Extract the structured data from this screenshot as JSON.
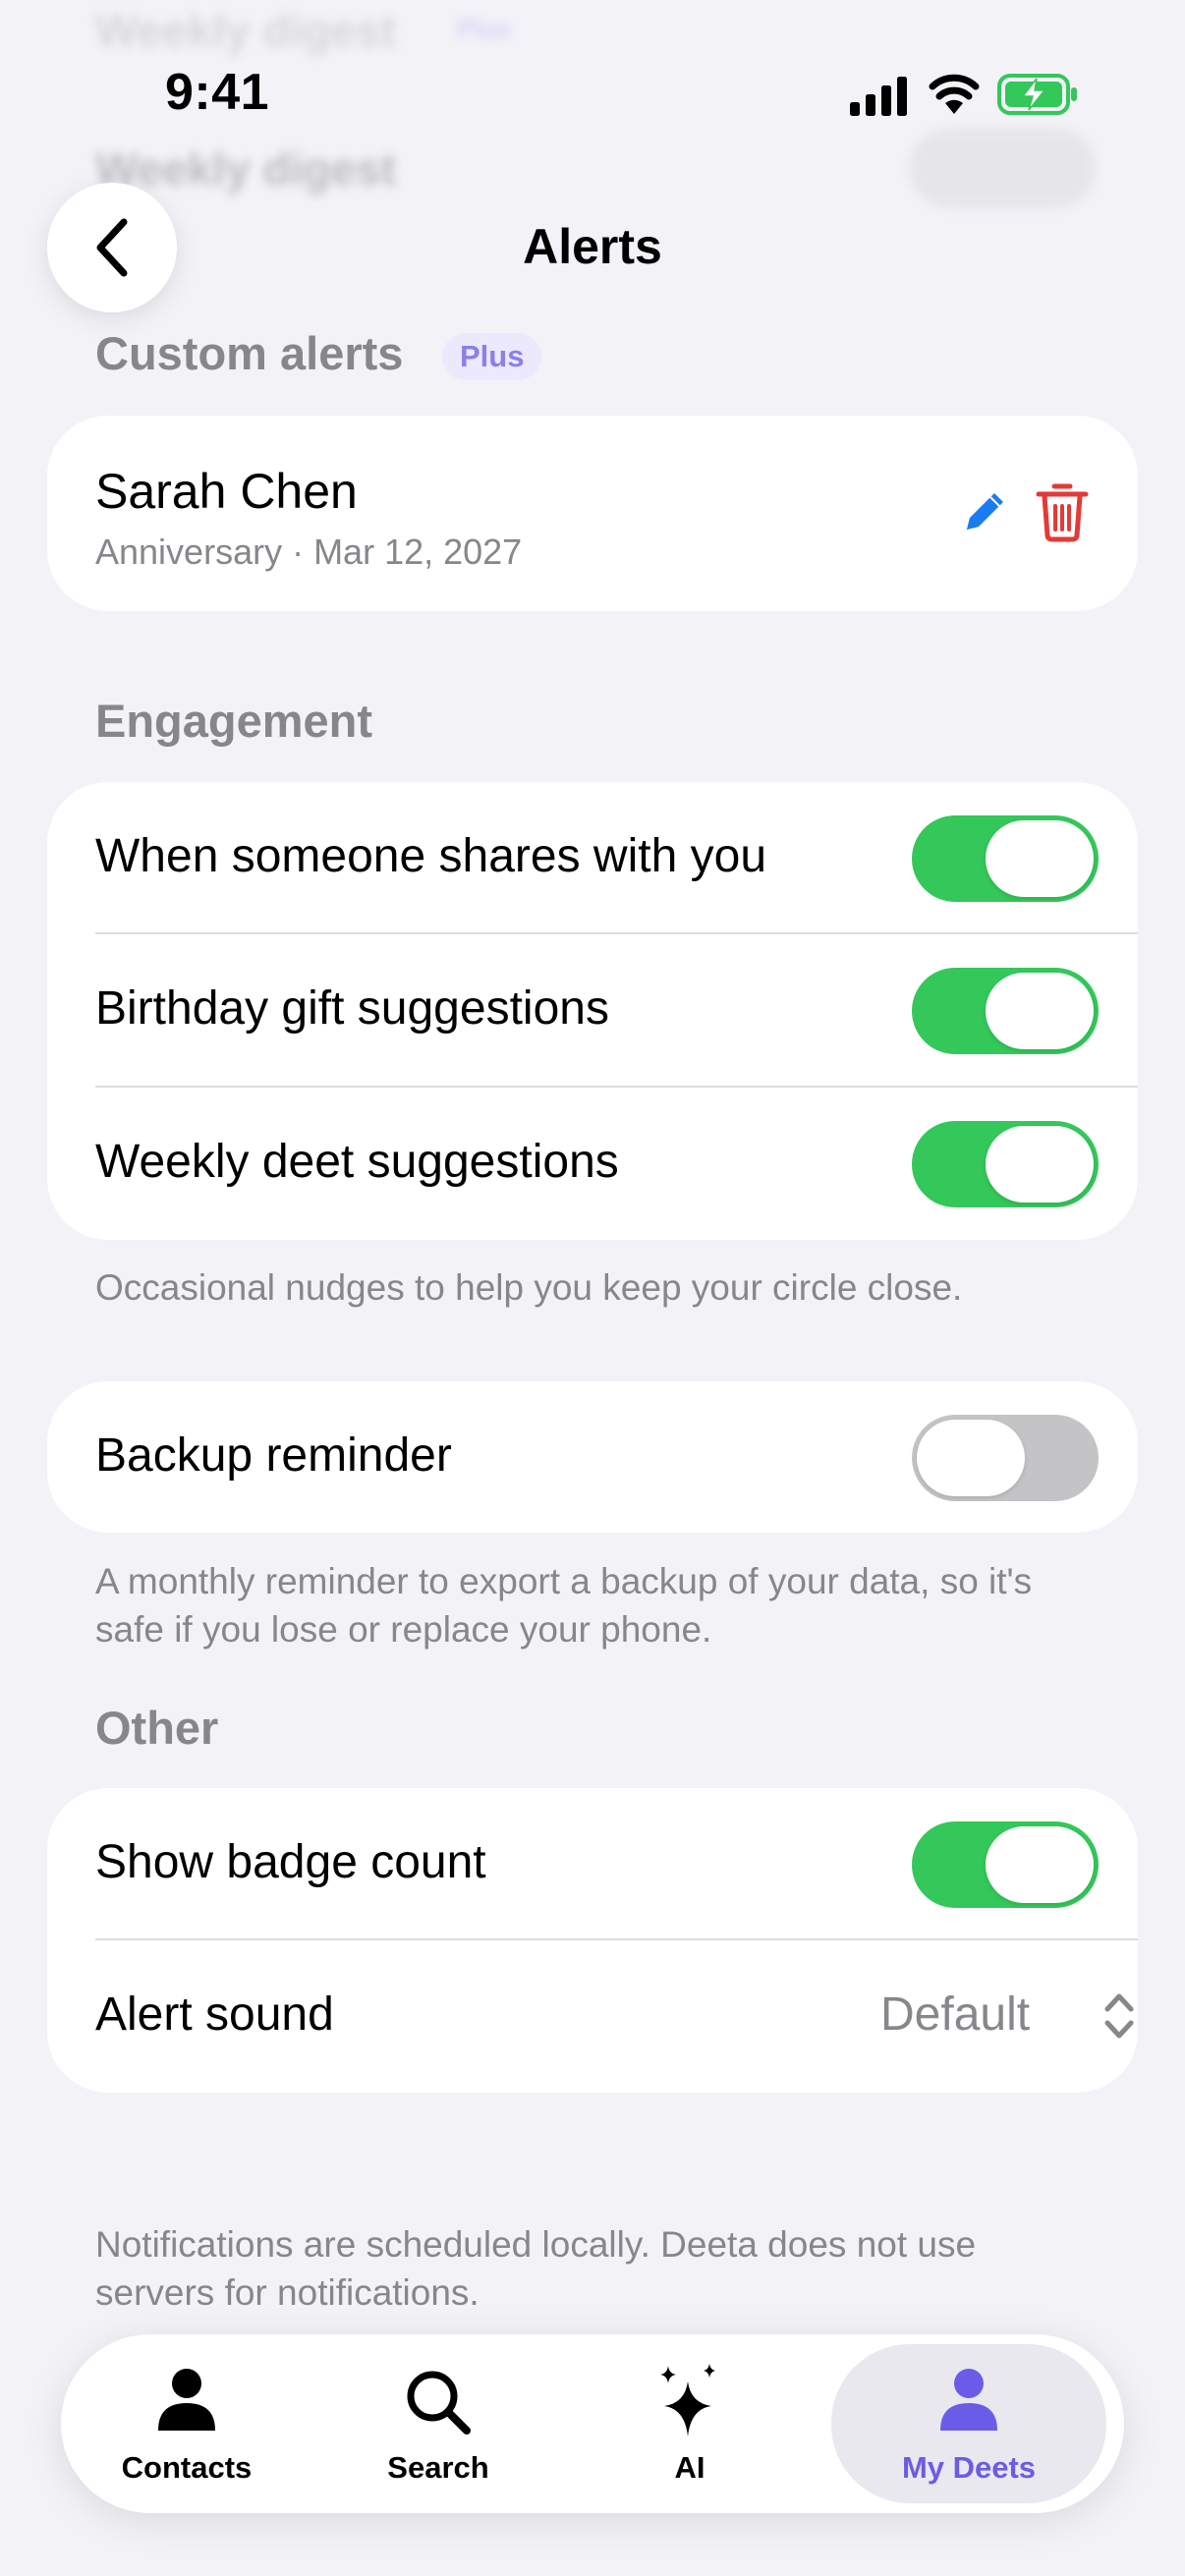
{
  "status_bar": {
    "time": "9:41"
  },
  "background_ghost": {
    "line1": "Weekly digest",
    "plus": "Plus",
    "line2": "Weekly digest"
  },
  "nav": {
    "title": "Alerts"
  },
  "custom_alerts": {
    "header": "Custom alerts",
    "badge": "Plus",
    "item": {
      "name": "Sarah Chen",
      "detail": "Anniversary · Mar 12, 2027"
    }
  },
  "engagement": {
    "header": "Engagement",
    "rows": [
      {
        "label": "When someone shares with you",
        "on": true
      },
      {
        "label": "Birthday gift suggestions",
        "on": true
      },
      {
        "label": "Weekly deet suggestions",
        "on": true
      }
    ],
    "footnote": "Occasional nudges to help you keep your circle close."
  },
  "backup": {
    "label": "Backup reminder",
    "on": false,
    "footnote": "A monthly reminder to export a backup of your data, so it's safe if you lose or replace your phone."
  },
  "other": {
    "header": "Other",
    "badge_count": {
      "label": "Show badge count",
      "on": true
    },
    "alert_sound": {
      "label": "Alert sound",
      "value": "Default"
    }
  },
  "bottom_note": "Notifications are scheduled locally. Deeta does not use servers for notifications.",
  "tabs": [
    {
      "label": "Contacts",
      "icon": "person-icon",
      "active": false
    },
    {
      "label": "Search",
      "icon": "magnifier-icon",
      "active": false
    },
    {
      "label": "AI",
      "icon": "sparkles-icon",
      "active": false
    },
    {
      "label": "My Deets",
      "icon": "person-icon",
      "active": true
    }
  ],
  "colors": {
    "toggle_on": "#34c759",
    "toggle_off": "#c4c4c7",
    "accent": "#6b5ce7",
    "edit": "#1a7cf0",
    "delete": "#e53935"
  }
}
